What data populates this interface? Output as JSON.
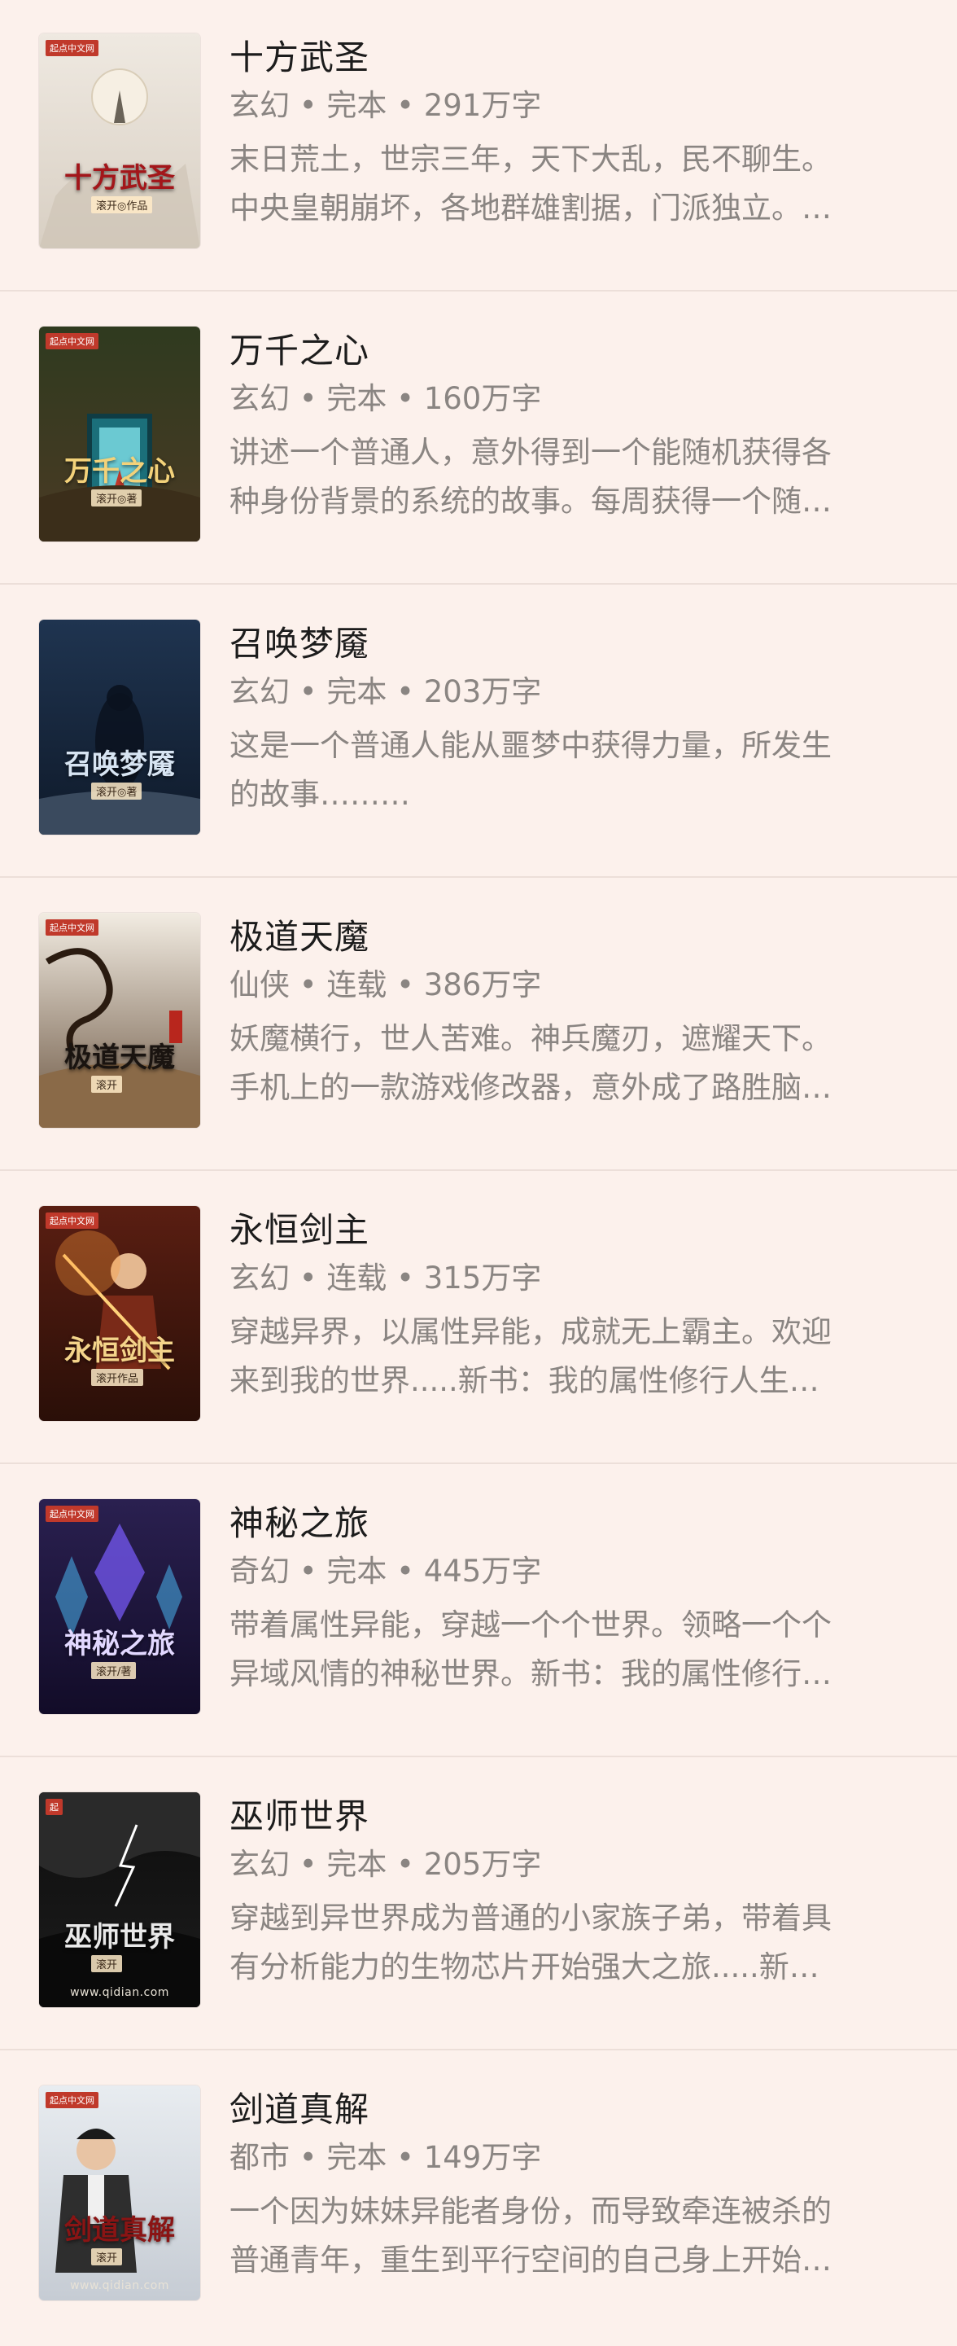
{
  "books": [
    {
      "title": "十方武圣",
      "meta": "玄幻 • 完本 • 291万字",
      "desc_line1": "末日荒土，世宗三年，天下大乱，民不聊生。",
      "desc_line2": "中央皇朝崩坏，各地群雄割据，门派独立。…",
      "cover": {
        "title": "十方武圣",
        "author": "滚开◎作品",
        "logo": "起点中文网",
        "site": "",
        "bg_top": "#efe9e1",
        "bg_bottom": "#d8cfc3",
        "title_color": "#a3161a",
        "icon": "moon-figure-icon"
      }
    },
    {
      "title": "万千之心",
      "meta": "玄幻 • 完本 • 160万字",
      "desc_line1": "讲述一个普通人，意外得到一个能随机获得各",
      "desc_line2": "种身份背景的系统的故事。每周获得一个随…",
      "cover": {
        "title": "万千之心",
        "author": "滚开◎著",
        "logo": "起点中文网",
        "site": "",
        "bg_top": "#2f3a1f",
        "bg_bottom": "#4a3a24",
        "title_color": "#f3d27a",
        "icon": "portal-gate-icon"
      }
    },
    {
      "title": "召唤梦魇",
      "meta": "玄幻 • 完本 • 203万字",
      "desc_line1": "这是一个普通人能从噩梦中获得力量，所发生",
      "desc_line2": "的故事………",
      "cover": {
        "title": "召唤梦魇",
        "author": "滚开◎著",
        "logo": "",
        "site": "",
        "bg_top": "#1f3450",
        "bg_bottom": "#0f1a2a",
        "title_color": "#d7e4f2",
        "icon": "shadow-figure-icon"
      }
    },
    {
      "title": "极道天魔",
      "meta": "仙侠 • 连载 • 386万字",
      "desc_line1": "妖魔横行，世人苦难。神兵魔刃，遮耀天下。",
      "desc_line2": "手机上的一款游戏修改器，意外成了路胜脑…",
      "cover": {
        "title": "极道天魔",
        "author": "滚开",
        "logo": "起点中文网",
        "site": "",
        "bg_top": "#f2ece2",
        "bg_bottom": "#6a5440",
        "title_color": "#1a1410",
        "icon": "dragon-icon"
      }
    },
    {
      "title": "永恒剑主",
      "meta": "玄幻 • 连载 • 315万字",
      "desc_line1": "穿越异界，以属性异能，成就无上霸主。欢迎",
      "desc_line2": "来到我的世界.....新书：我的属性修行人生…",
      "cover": {
        "title": "永恒剑主",
        "author": "滚开作品",
        "logo": "起点中文网",
        "site": "",
        "bg_top": "#5a1e12",
        "bg_bottom": "#2a0f08",
        "title_color": "#f4d48a",
        "icon": "warrior-icon"
      }
    },
    {
      "title": "神秘之旅",
      "meta": "奇幻 • 完本 • 445万字",
      "desc_line1": "带着属性异能，穿越一个个世界。领略一个个",
      "desc_line2": "异域风情的神秘世界。新书：我的属性修行…",
      "cover": {
        "title": "神秘之旅",
        "author": "滚开/著",
        "logo": "起点中文网",
        "site": "",
        "bg_top": "#2a2050",
        "bg_bottom": "#120c28",
        "title_color": "#e2d8ff",
        "icon": "crystal-icon"
      }
    },
    {
      "title": "巫师世界",
      "meta": "玄幻 • 完本 • 205万字",
      "desc_line1": "穿越到异世界成为普通的小家族子弟，带着具",
      "desc_line2": "有分析能力的生物芯片开始强大之旅.....新…",
      "cover": {
        "title": "巫师世界",
        "author": "滚开",
        "logo": "起",
        "site": "www.qidian.com",
        "bg_top": "#0c0c0c",
        "bg_bottom": "#1e1e1e",
        "title_color": "#e8e8e8",
        "icon": "storm-icon"
      }
    },
    {
      "title": "剑道真解",
      "meta": "都市 • 完本 • 149万字",
      "desc_line1": "一个因为妹妹异能者身份，而导致牵连被杀的",
      "desc_line2": "普通青年，重生到平行空间的自己身上开始…",
      "cover": {
        "title": "剑道真解",
        "author": "滚开",
        "logo": "起点中文网",
        "site": "www.qidian.com",
        "bg_top": "#e8ecf0",
        "bg_bottom": "#c6ccd4",
        "title_color": "#8a1414",
        "icon": "young-man-icon"
      }
    }
  ]
}
